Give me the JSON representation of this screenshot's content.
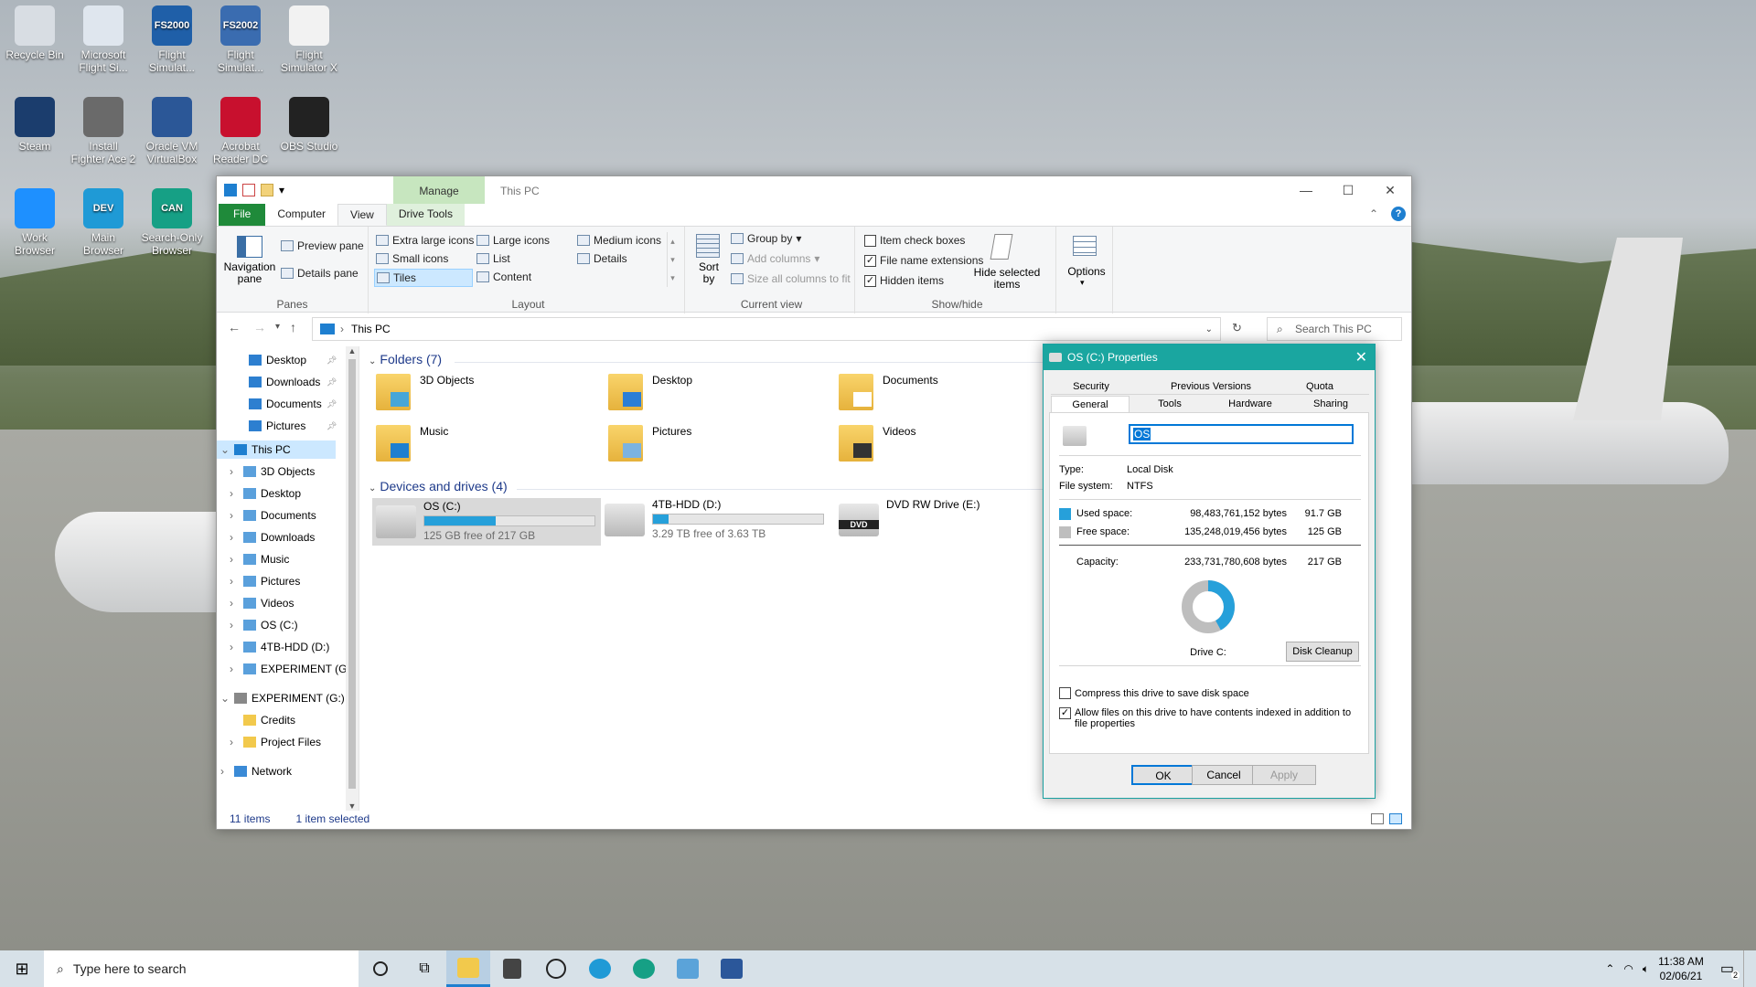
{
  "desktop": {
    "icons": [
      {
        "label": "Recycle Bin",
        "icon": "recycle-bin-icon",
        "color": "#d8dde3"
      },
      {
        "label": "Microsoft Flight Si...",
        "icon": "flight-sim-icon",
        "color": "#dfe6ee"
      },
      {
        "label": "Flight Simulat...",
        "badge": "FS2000",
        "icon": "fs2000-icon",
        "color": "#1f5fa8"
      },
      {
        "label": "Flight Simulat...",
        "badge": "FS2002",
        "icon": "fs2002-icon",
        "color": "#3a6cb0"
      },
      {
        "label": "Flight Simulator X",
        "icon": "document-icon",
        "color": "#f2f2f2"
      },
      {
        "label": "Steam",
        "icon": "steam-icon",
        "color": "#1b3d6d"
      },
      {
        "label": "Install Fighter Ace 2",
        "icon": "fighter-ace-icon",
        "color": "#6a6a6a"
      },
      {
        "label": "Oracle VM VirtualBox",
        "icon": "virtualbox-icon",
        "color": "#2b5797"
      },
      {
        "label": "Acrobat Reader DC",
        "icon": "acrobat-icon",
        "color": "#c8102e"
      },
      {
        "label": "OBS Studio",
        "icon": "obs-icon",
        "color": "#222222"
      },
      {
        "label": "Work Browser",
        "icon": "ie-icon",
        "color": "#1e90ff"
      },
      {
        "label": "Main Browser",
        "badge": "DEV",
        "icon": "edge-dev-icon",
        "color": "#1f9ad6"
      },
      {
        "label": "Search-Only Browser",
        "badge": "CAN",
        "icon": "edge-canary-icon",
        "color": "#16a085"
      }
    ]
  },
  "explorer": {
    "title": "This PC",
    "manage_tab": "Manage",
    "tabs": [
      "File",
      "Computer",
      "View",
      "Drive Tools"
    ],
    "ribbon": {
      "panes": {
        "label": "Panes",
        "navigation": "Navigation pane",
        "preview": "Preview pane",
        "details": "Details pane"
      },
      "layout": {
        "label": "Layout",
        "items": [
          "Extra large icons",
          "Large icons",
          "Medium icons",
          "Small icons",
          "List",
          "Details",
          "Tiles",
          "Content"
        ]
      },
      "current_view": {
        "label": "Current view",
        "sort": "Sort by",
        "group": "Group by",
        "add_columns": "Add columns",
        "size_columns": "Size all columns to fit"
      },
      "show_hide": {
        "label": "Show/hide",
        "item_check": "Item check boxes",
        "extensions": "File name extensions",
        "hidden": "Hidden items",
        "hide_selected": "Hide selected items",
        "item_check_checked": false,
        "extensions_checked": true,
        "hidden_checked": true
      },
      "options": "Options"
    },
    "address": {
      "path": "This PC",
      "search_placeholder": "Search This PC"
    },
    "nav": {
      "quick": [
        "Desktop",
        "Downloads",
        "Documents",
        "Pictures"
      ],
      "this_pc": "This PC",
      "this_pc_items": [
        "3D Objects",
        "Desktop",
        "Documents",
        "Downloads",
        "Music",
        "Pictures",
        "Videos",
        "OS (C:)",
        "4TB-HDD (D:)",
        "EXPERIMENT (G:)"
      ],
      "experiment": "EXPERIMENT (G:)",
      "experiment_items": [
        "Credits",
        "Project Files"
      ],
      "network": "Network"
    },
    "folders_header": "Folders (7)",
    "folders": [
      "3D Objects",
      "Desktop",
      "Documents",
      "Music",
      "Pictures",
      "Videos"
    ],
    "drives_header": "Devices and drives (4)",
    "drives": [
      {
        "name": "OS (C:)",
        "free": "125 GB free of 217 GB",
        "used_fraction": 0.42
      },
      {
        "name": "4TB-HDD (D:)",
        "free": "3.29 TB free of 3.63 TB",
        "used_fraction": 0.09
      },
      {
        "name": "DVD RW Drive (E:)",
        "badge": "DVD"
      }
    ],
    "status": {
      "items": "11 items",
      "selected": "1 item selected"
    }
  },
  "properties": {
    "title": "OS (C:) Properties",
    "tabs_top": [
      "Security",
      "Previous Versions",
      "Quota"
    ],
    "tabs_bottom": [
      "General",
      "Tools",
      "Hardware",
      "Sharing"
    ],
    "name_value": "OS",
    "type_label": "Type:",
    "type_value": "Local Disk",
    "fs_label": "File system:",
    "fs_value": "NTFS",
    "used_label": "Used space:",
    "used_bytes": "98,483,761,152 bytes",
    "used_gb": "91.7 GB",
    "free_label": "Free space:",
    "free_bytes": "135,248,019,456 bytes",
    "free_gb": "125 GB",
    "cap_label": "Capacity:",
    "cap_bytes": "233,731,780,608 bytes",
    "cap_gb": "217 GB",
    "drive_label": "Drive C:",
    "used_fraction": 0.42,
    "cleanup": "Disk Cleanup",
    "compress": "Compress this drive to save disk space",
    "compress_checked": false,
    "index": "Allow files on this drive to have contents indexed in addition to file properties",
    "index_checked": true,
    "ok": "OK",
    "cancel": "Cancel",
    "apply": "Apply",
    "colors": {
      "used": "#26a0da",
      "free": "#bebebe"
    }
  },
  "taskbar": {
    "search_placeholder": "Type here to search",
    "time": "11:38 AM",
    "date": "02/06/21",
    "notifications": "2"
  }
}
